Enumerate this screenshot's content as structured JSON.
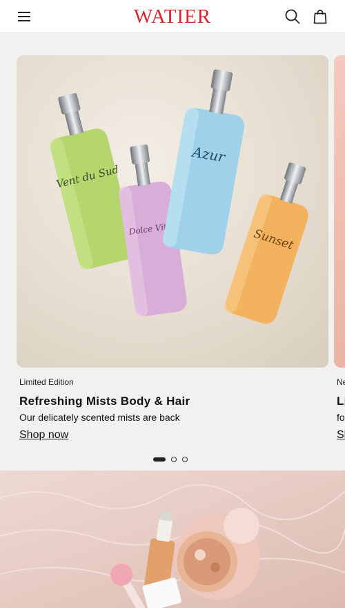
{
  "header": {
    "logo_text": "WATIER",
    "menu_icon": "hamburger-menu-icon",
    "search_icon": "search-icon",
    "bag_icon": "shopping-bag-icon",
    "brand_color": "#d7262f"
  },
  "carousel": {
    "slides": [
      {
        "eyebrow": "Limited Edition",
        "title": "Refreshing Mists Body & Hair",
        "description": "Our delicately scented mists are back",
        "cta": "Shop now",
        "bottle_labels": [
          "Vent du Sud",
          "Dolce Vita",
          "Azur",
          "Sunset"
        ]
      },
      {
        "eyebrow": "Ne",
        "title": "Li",
        "description": "fo",
        "cta": "Sh"
      }
    ],
    "active_index": 0,
    "total": 3
  },
  "hero": {
    "image": "pink-makeup-products-on-water"
  }
}
